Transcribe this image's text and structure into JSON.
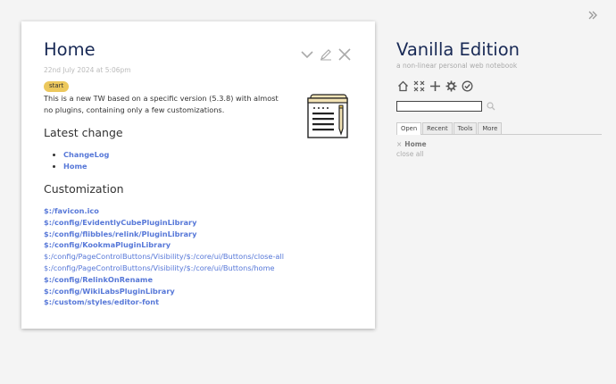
{
  "tiddler": {
    "title": "Home",
    "subtitle": "22nd July 2024 at 5:06pm",
    "tag": "start",
    "body": "This is a new TW based on a specific version (5.3.8) with almost no plugins, containing only a few customizations.",
    "latest_heading": "Latest change",
    "latest_links": [
      "ChangeLog",
      "Home"
    ],
    "customization_heading": "Customization",
    "customization_links": [
      {
        "text": "$:/favicon.ico",
        "missing": false
      },
      {
        "text": "$:/config/EvidentlyCubePluginLibrary",
        "missing": false
      },
      {
        "text": "$:/config/flibbles/relink/PluginLibrary",
        "missing": false
      },
      {
        "text": "$:/config/KookmaPluginLibrary",
        "missing": false
      },
      {
        "text": "$:/config/PageControlButtons/Visibility/$:/core/ui/Buttons/close-all",
        "missing": true
      },
      {
        "text": "$:/config/PageControlButtons/Visibility/$:/core/ui/Buttons/home",
        "missing": true
      },
      {
        "text": "$:/config/RelinkOnRename",
        "missing": false
      },
      {
        "text": "$:/config/WikiLabsPluginLibrary",
        "missing": false
      },
      {
        "text": "$:/custom/styles/editor-font",
        "missing": false
      }
    ]
  },
  "sidebar": {
    "site_title": "Vanilla Edition",
    "site_subtitle": "a non-linear personal web notebook",
    "page_controls": [
      "home-icon",
      "close-all-icon",
      "new-tiddler-icon",
      "control-panel-icon",
      "save-icon"
    ],
    "search": {
      "value": "",
      "placeholder": ""
    },
    "tabs": [
      "Open",
      "Recent",
      "Tools",
      "More"
    ],
    "active_tab": "Open",
    "open_items": [
      "Home"
    ],
    "close_all": "close all"
  },
  "colors": {
    "title": "#182955",
    "link": "#5778d8",
    "tag_bg": "#ecc85d",
    "page_bg": "#f4f4f4"
  }
}
